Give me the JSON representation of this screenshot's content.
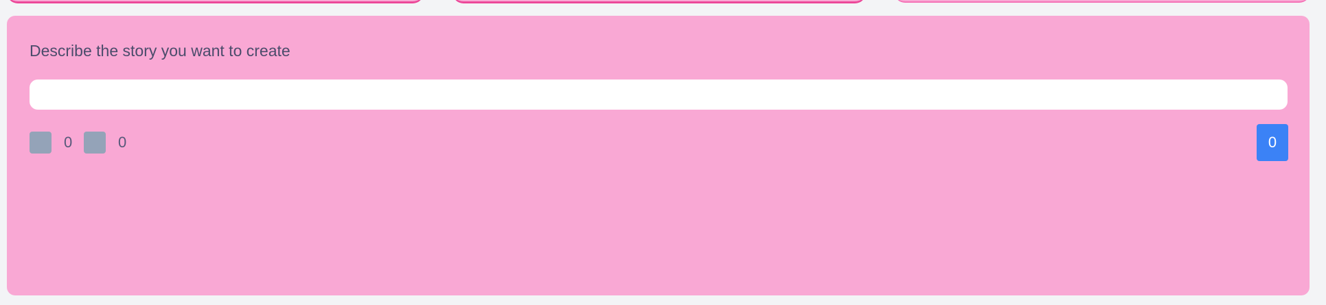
{
  "panel": {
    "prompt_label": "Describe the story you want to create",
    "prompt_value": "",
    "prompt_placeholder": ""
  },
  "stats": [
    {
      "icon": "image-placeholder-icon",
      "count": "0"
    },
    {
      "icon": "image-placeholder-icon",
      "count": "0"
    }
  ],
  "action_button": {
    "label": "0"
  },
  "colors": {
    "page_background": "#f3f4f6",
    "panel_background": "#f9a8d4",
    "tab_accent": "#ec4899",
    "stat_icon": "#94a3b8",
    "button": "#3b82f6"
  }
}
